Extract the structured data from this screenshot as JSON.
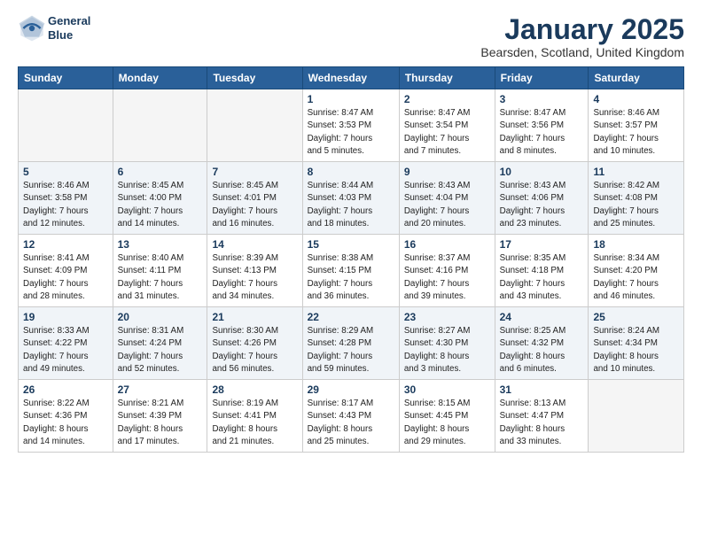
{
  "logo": {
    "line1": "General",
    "line2": "Blue"
  },
  "title": "January 2025",
  "subtitle": "Bearsden, Scotland, United Kingdom",
  "weekdays": [
    "Sunday",
    "Monday",
    "Tuesday",
    "Wednesday",
    "Thursday",
    "Friday",
    "Saturday"
  ],
  "weeks": [
    [
      {
        "day": "",
        "info": ""
      },
      {
        "day": "",
        "info": ""
      },
      {
        "day": "",
        "info": ""
      },
      {
        "day": "1",
        "info": "Sunrise: 8:47 AM\nSunset: 3:53 PM\nDaylight: 7 hours\nand 5 minutes."
      },
      {
        "day": "2",
        "info": "Sunrise: 8:47 AM\nSunset: 3:54 PM\nDaylight: 7 hours\nand 7 minutes."
      },
      {
        "day": "3",
        "info": "Sunrise: 8:47 AM\nSunset: 3:56 PM\nDaylight: 7 hours\nand 8 minutes."
      },
      {
        "day": "4",
        "info": "Sunrise: 8:46 AM\nSunset: 3:57 PM\nDaylight: 7 hours\nand 10 minutes."
      }
    ],
    [
      {
        "day": "5",
        "info": "Sunrise: 8:46 AM\nSunset: 3:58 PM\nDaylight: 7 hours\nand 12 minutes."
      },
      {
        "day": "6",
        "info": "Sunrise: 8:45 AM\nSunset: 4:00 PM\nDaylight: 7 hours\nand 14 minutes."
      },
      {
        "day": "7",
        "info": "Sunrise: 8:45 AM\nSunset: 4:01 PM\nDaylight: 7 hours\nand 16 minutes."
      },
      {
        "day": "8",
        "info": "Sunrise: 8:44 AM\nSunset: 4:03 PM\nDaylight: 7 hours\nand 18 minutes."
      },
      {
        "day": "9",
        "info": "Sunrise: 8:43 AM\nSunset: 4:04 PM\nDaylight: 7 hours\nand 20 minutes."
      },
      {
        "day": "10",
        "info": "Sunrise: 8:43 AM\nSunset: 4:06 PM\nDaylight: 7 hours\nand 23 minutes."
      },
      {
        "day": "11",
        "info": "Sunrise: 8:42 AM\nSunset: 4:08 PM\nDaylight: 7 hours\nand 25 minutes."
      }
    ],
    [
      {
        "day": "12",
        "info": "Sunrise: 8:41 AM\nSunset: 4:09 PM\nDaylight: 7 hours\nand 28 minutes."
      },
      {
        "day": "13",
        "info": "Sunrise: 8:40 AM\nSunset: 4:11 PM\nDaylight: 7 hours\nand 31 minutes."
      },
      {
        "day": "14",
        "info": "Sunrise: 8:39 AM\nSunset: 4:13 PM\nDaylight: 7 hours\nand 34 minutes."
      },
      {
        "day": "15",
        "info": "Sunrise: 8:38 AM\nSunset: 4:15 PM\nDaylight: 7 hours\nand 36 minutes."
      },
      {
        "day": "16",
        "info": "Sunrise: 8:37 AM\nSunset: 4:16 PM\nDaylight: 7 hours\nand 39 minutes."
      },
      {
        "day": "17",
        "info": "Sunrise: 8:35 AM\nSunset: 4:18 PM\nDaylight: 7 hours\nand 43 minutes."
      },
      {
        "day": "18",
        "info": "Sunrise: 8:34 AM\nSunset: 4:20 PM\nDaylight: 7 hours\nand 46 minutes."
      }
    ],
    [
      {
        "day": "19",
        "info": "Sunrise: 8:33 AM\nSunset: 4:22 PM\nDaylight: 7 hours\nand 49 minutes."
      },
      {
        "day": "20",
        "info": "Sunrise: 8:31 AM\nSunset: 4:24 PM\nDaylight: 7 hours\nand 52 minutes."
      },
      {
        "day": "21",
        "info": "Sunrise: 8:30 AM\nSunset: 4:26 PM\nDaylight: 7 hours\nand 56 minutes."
      },
      {
        "day": "22",
        "info": "Sunrise: 8:29 AM\nSunset: 4:28 PM\nDaylight: 7 hours\nand 59 minutes."
      },
      {
        "day": "23",
        "info": "Sunrise: 8:27 AM\nSunset: 4:30 PM\nDaylight: 8 hours\nand 3 minutes."
      },
      {
        "day": "24",
        "info": "Sunrise: 8:25 AM\nSunset: 4:32 PM\nDaylight: 8 hours\nand 6 minutes."
      },
      {
        "day": "25",
        "info": "Sunrise: 8:24 AM\nSunset: 4:34 PM\nDaylight: 8 hours\nand 10 minutes."
      }
    ],
    [
      {
        "day": "26",
        "info": "Sunrise: 8:22 AM\nSunset: 4:36 PM\nDaylight: 8 hours\nand 14 minutes."
      },
      {
        "day": "27",
        "info": "Sunrise: 8:21 AM\nSunset: 4:39 PM\nDaylight: 8 hours\nand 17 minutes."
      },
      {
        "day": "28",
        "info": "Sunrise: 8:19 AM\nSunset: 4:41 PM\nDaylight: 8 hours\nand 21 minutes."
      },
      {
        "day": "29",
        "info": "Sunrise: 8:17 AM\nSunset: 4:43 PM\nDaylight: 8 hours\nand 25 minutes."
      },
      {
        "day": "30",
        "info": "Sunrise: 8:15 AM\nSunset: 4:45 PM\nDaylight: 8 hours\nand 29 minutes."
      },
      {
        "day": "31",
        "info": "Sunrise: 8:13 AM\nSunset: 4:47 PM\nDaylight: 8 hours\nand 33 minutes."
      },
      {
        "day": "",
        "info": ""
      }
    ]
  ]
}
